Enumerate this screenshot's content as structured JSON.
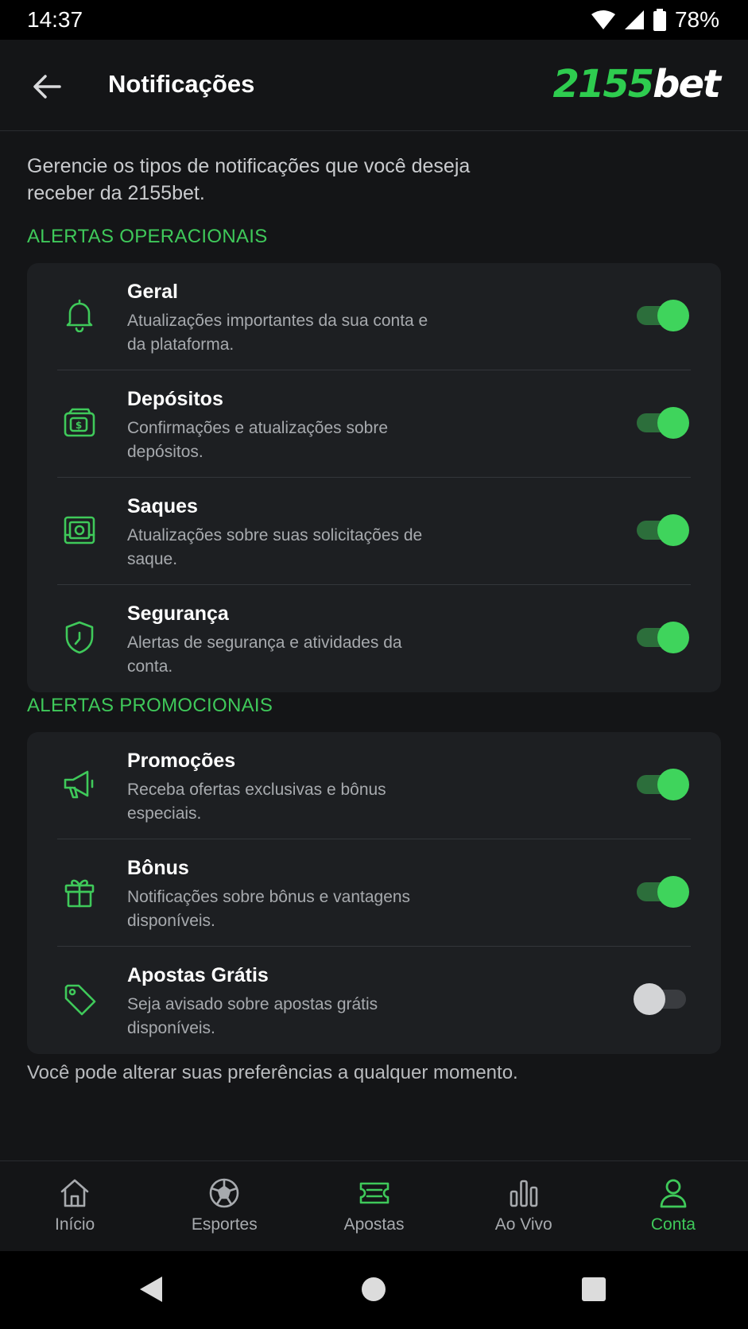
{
  "status_bar": {
    "time": "14:37",
    "battery": "78%"
  },
  "header": {
    "title": "Notificações",
    "logo_number": "2155",
    "logo_text": "bet"
  },
  "intro": "Gerencie os tipos de notificações que você deseja receber da 2155bet.",
  "sections": [
    {
      "title": "ALERTAS OPERACIONAIS",
      "items": [
        {
          "icon": "bell-icon",
          "title": "Geral",
          "desc": "Atualizações importantes da sua conta e da plataforma.",
          "enabled": true
        },
        {
          "icon": "wallet-icon",
          "title": "Depósitos",
          "desc": "Confirmações e atualizações sobre depósitos.",
          "enabled": true
        },
        {
          "icon": "cash-icon",
          "title": "Saques",
          "desc": "Atualizações sobre suas solicitações de saque.",
          "enabled": true
        },
        {
          "icon": "shield-icon",
          "title": "Segurança",
          "desc": "Alertas de segurança e atividades da conta.",
          "enabled": true
        }
      ]
    },
    {
      "title": "ALERTAS PROMOCIONAIS",
      "items": [
        {
          "icon": "megaphone-icon",
          "title": "Promoções",
          "desc": "Receba ofertas exclusivas e bônus especiais.",
          "enabled": true
        },
        {
          "icon": "gift-icon",
          "title": "Bônus",
          "desc": "Notificações sobre bônus e vantagens disponíveis.",
          "enabled": true
        },
        {
          "icon": "tag-icon",
          "title": "Apostas Grátis",
          "desc": "Seja avisado sobre apostas grátis disponíveis.",
          "enabled": false
        }
      ]
    }
  ],
  "footer_note": "Você pode alterar suas preferências a qualquer momento.",
  "bottom_nav": [
    {
      "icon": "home-icon",
      "label": "Início",
      "active": false
    },
    {
      "icon": "soccer-ball-icon",
      "label": "Esportes",
      "active": false
    },
    {
      "icon": "ticket-icon",
      "label": "Apostas",
      "active": false
    },
    {
      "icon": "bar-chart-icon",
      "label": "Ao Vivo",
      "active": false
    },
    {
      "icon": "user-icon",
      "label": "Conta",
      "active": true
    }
  ],
  "colors": {
    "accent": "#3fc95a",
    "background": "#141517",
    "card": "#1d1f22"
  }
}
